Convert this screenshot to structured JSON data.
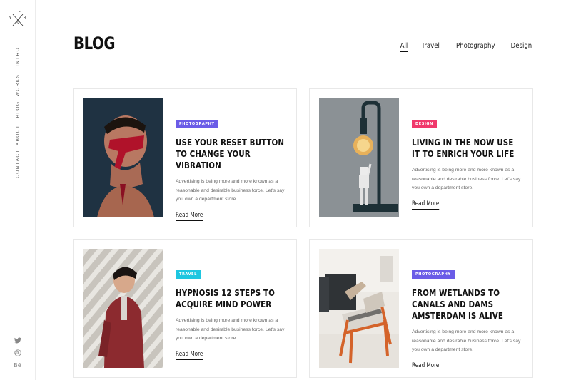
{
  "logo": {
    "letters": [
      "F",
      "N",
      "R",
      "S"
    ]
  },
  "sidebar": {
    "nav": [
      {
        "label": "INTRO"
      },
      {
        "label": "WORKS"
      },
      {
        "label": "BLOG"
      },
      {
        "label": "ABOUT"
      },
      {
        "label": "CONTACT"
      }
    ],
    "social": [
      {
        "icon": "twitter-icon"
      },
      {
        "icon": "dribbble-icon"
      },
      {
        "icon": "behance-icon",
        "label": "Bē"
      }
    ]
  },
  "header": {
    "title": "BLOG",
    "filters": [
      {
        "label": "All",
        "active": true
      },
      {
        "label": "Travel",
        "active": false
      },
      {
        "label": "Photography",
        "active": false
      },
      {
        "label": "Design",
        "active": false
      }
    ]
  },
  "posts": [
    {
      "category": "PHOTOGRAPHY",
      "category_color": "#6b5ce7",
      "title": "USE YOUR RESET BUTTON TO CHANGE YOUR VIBRATION",
      "excerpt": "Advertising is being more and more known as a reasonable and desirable business force. Let's say you own a department store.",
      "read_more": "Read More"
    },
    {
      "category": "DESIGN",
      "category_color": "#f0386b",
      "title": "LIVING IN THE NOW USE IT TO ENRICH YOUR LIFE",
      "excerpt": "Advertising is being more and more known as a reasonable and desirable business force. Let's say you own a department store.",
      "read_more": "Read More"
    },
    {
      "category": "TRAVEL",
      "category_color": "#1ec6e0",
      "title": "HYPNOSIS 12 STEPS TO ACQUIRE MIND POWER",
      "excerpt": "Advertising is being more and more known as a reasonable and desirable business force. Let's say you own a department store.",
      "read_more": "Read More"
    },
    {
      "category": "PHOTOGRAPHY",
      "category_color": "#6b5ce7",
      "title": "FROM WETLANDS TO CANALS AND DAMS AMSTERDAM IS ALIVE",
      "excerpt": "Advertising is being more and more known as a reasonable and desirable business force. Let's say you own a department store.",
      "read_more": "Read More"
    }
  ]
}
